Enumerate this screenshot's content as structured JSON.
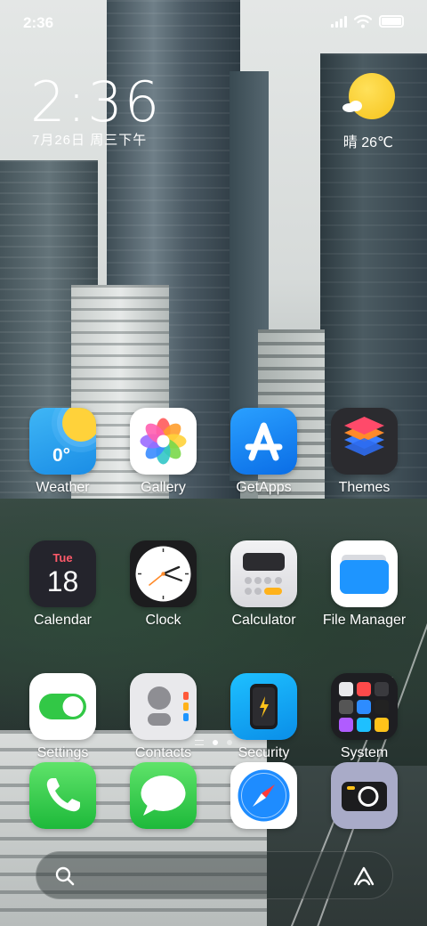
{
  "status_bar": {
    "time": "2:36",
    "icons": [
      "signal-icon",
      "wifi-icon",
      "battery-icon"
    ]
  },
  "clock_widget": {
    "time": "2:36",
    "date": "7月26日 周三下午"
  },
  "weather_widget": {
    "condition_temp": "晴 26℃",
    "icon": "sun-cloud-icon"
  },
  "apps": [
    {
      "label": "Weather",
      "icon": "weather-icon",
      "detail": "0°"
    },
    {
      "label": "Gallery",
      "icon": "gallery-flower-icon"
    },
    {
      "label": "GetApps",
      "icon": "getapps-a-icon"
    },
    {
      "label": "Themes",
      "icon": "themes-layers-icon"
    },
    {
      "label": "Calendar",
      "icon": "calendar-icon",
      "day": "Tue",
      "date": "18"
    },
    {
      "label": "Clock",
      "icon": "clock-face-icon"
    },
    {
      "label": "Calculator",
      "icon": "calculator-icon"
    },
    {
      "label": "File Manager",
      "icon": "folder-icon"
    },
    {
      "label": "Settings",
      "icon": "toggle-switch-icon"
    },
    {
      "label": "Contacts",
      "icon": "contacts-icon"
    },
    {
      "label": "Security",
      "icon": "security-phone-icon"
    },
    {
      "label": "System",
      "icon": "system-folder-icon"
    }
  ],
  "dock": [
    {
      "icon": "phone-icon"
    },
    {
      "icon": "messages-icon"
    },
    {
      "icon": "safari-compass-icon"
    },
    {
      "icon": "camera-icon"
    }
  ],
  "page_indicator": {
    "pages": 2,
    "current": 1
  },
  "search_bar": {
    "left_icon": "search-icon",
    "right_icon": "assistant-icon"
  },
  "colors": {
    "weather_bg": "#1a8de6",
    "getapps_bg": "#0a6de6",
    "security_bg": "#0a8ee8",
    "phone_green": "#1db93a",
    "sun_yellow": "#f6c31b",
    "calendar_red": "#ff5a6a"
  }
}
